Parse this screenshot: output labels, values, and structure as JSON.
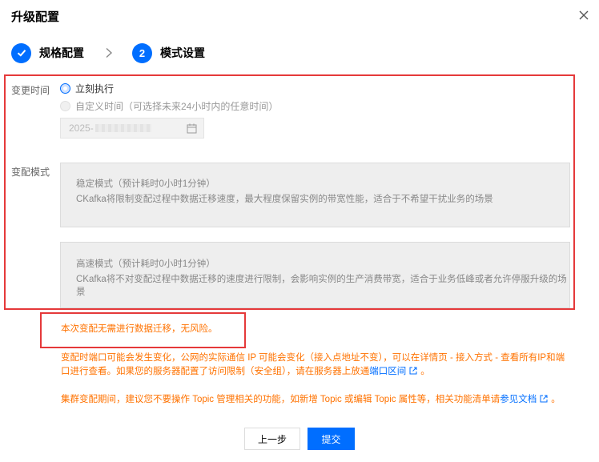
{
  "dialog": {
    "title": "升级配置"
  },
  "steps": [
    {
      "number": "1",
      "label": "规格配置",
      "status": "done"
    },
    {
      "number": "2",
      "label": "模式设置",
      "status": "current"
    }
  ],
  "change_time": {
    "label": "变更时间",
    "options": [
      {
        "label": "立刻执行",
        "checked": true,
        "disabled": false
      },
      {
        "label": "自定义时间（可选择未来24小时内的任意时间）",
        "checked": false,
        "disabled": true
      }
    ],
    "date_value": "2025-"
  },
  "change_mode": {
    "label": "变配模式",
    "options": [
      {
        "title": "稳定模式（预计耗时0小时1分钟）",
        "desc": "CKafka将限制变配过程中数据迁移速度，最大程度保留实例的带宽性能，适合于不希望干扰业务的场景"
      },
      {
        "title": "高速模式（预计耗时0小时1分钟）",
        "desc": "CKafka将不对变配过程中数据迁移的速度进行限制，会影响实例的生产消费带宽，适合于业务低峰或者允许停服升级的场景"
      }
    ]
  },
  "notices": {
    "no_migration": "本次变配无需进行数据迁移，无风险。",
    "port_notice_before": "变配时端口可能会发生变化，公网的实际通信 IP 可能会变化（接入点地址不变），可以在详情页 - 接入方式 - 查看所有IP和端口进行查看。如果您的服务器配置了访问限制（安全组），请在服务器上放通",
    "port_link": "端口区间",
    "port_notice_after": "。",
    "cluster_notice_before": "集群变配期间，建议您不要操作 Topic 管理相关的功能，如新增 Topic 或编辑 Topic 属性等，相关功能清单请",
    "doc_link": "参见文档",
    "cluster_notice_after": "。"
  },
  "buttons": {
    "prev": "上一步",
    "submit": "提交"
  },
  "colors": {
    "primary": "#006eff",
    "warning": "#ff7200",
    "highlight_border": "#e5393a"
  },
  "icons": [
    "close-icon",
    "check-icon",
    "chevron-right-icon",
    "calendar-icon",
    "external-link-icon"
  ]
}
